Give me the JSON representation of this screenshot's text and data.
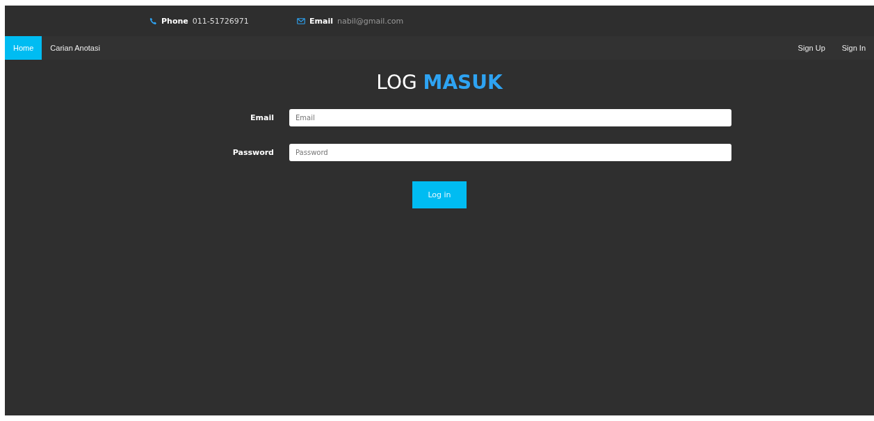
{
  "contact_bar": {
    "phone": {
      "label": "Phone",
      "value": "011-51726971"
    },
    "email": {
      "label": "Email",
      "value": "nabil@gmail.com"
    }
  },
  "nav": {
    "items": [
      {
        "label": "Home",
        "selected": true
      },
      {
        "label": "Carian Anotasi",
        "selected": false
      }
    ],
    "right_items": [
      "Sign Up",
      "Sign In"
    ]
  },
  "title": {
    "text": "LOG",
    "highlight": "MASUK"
  },
  "form": {
    "fields": [
      {
        "label": "Email",
        "placeholder": "Email"
      },
      {
        "label": "Password",
        "placeholder": "Password"
      }
    ],
    "submit": "Log in"
  }
}
